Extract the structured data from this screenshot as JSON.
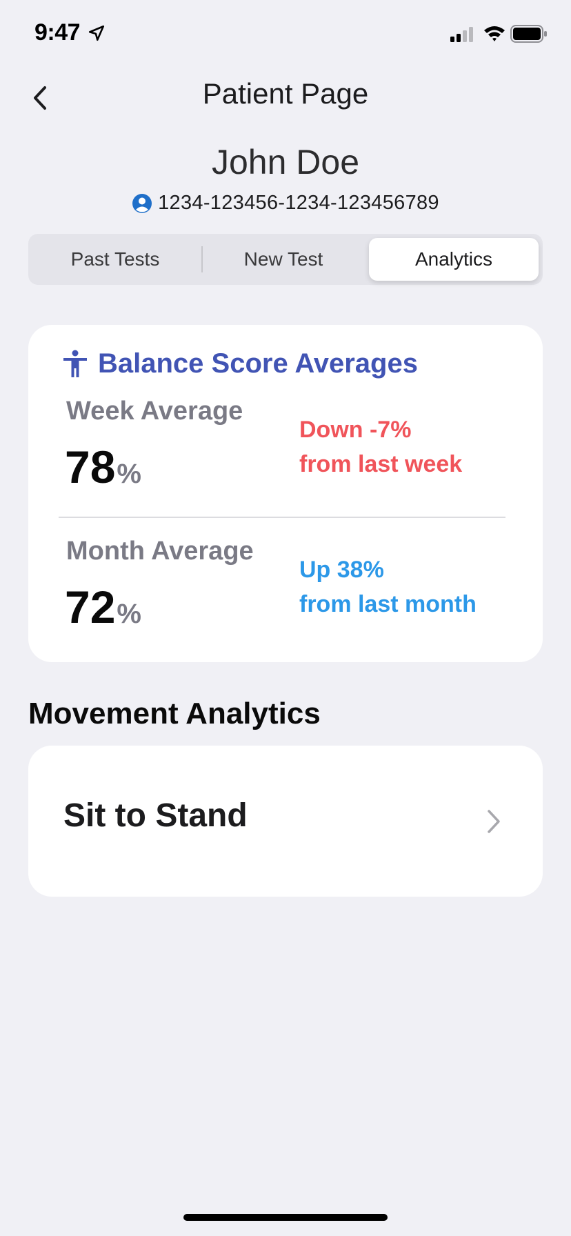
{
  "status_bar": {
    "time": "9:47"
  },
  "nav": {
    "title": "Patient Page"
  },
  "patient": {
    "name": "John Doe",
    "id": "1234-123456-1234-123456789"
  },
  "tabs": [
    {
      "label": "Past Tests",
      "selected": false
    },
    {
      "label": "New Test",
      "selected": false
    },
    {
      "label": "Analytics",
      "selected": true
    }
  ],
  "balance": {
    "title": "Balance Score Averages",
    "week": {
      "label": "Week Average",
      "value": "78",
      "unit": "%",
      "trend_line1": "Down -7%",
      "trend_line2": "from last week"
    },
    "month": {
      "label": "Month Average",
      "value": "72",
      "unit": "%",
      "trend_line1": "Up 38%",
      "trend_line2": "from last month"
    }
  },
  "movement": {
    "section_title": "Movement Analytics",
    "items": [
      {
        "label": "Sit to Stand"
      }
    ]
  },
  "colors": {
    "accent": "#4154b4",
    "trend_down": "#f0545a",
    "trend_up": "#2c98e8",
    "background": "#f0f0f5"
  },
  "icons": {
    "back": "chevron-left-icon",
    "patient": "user-circle-icon",
    "balance": "accessibility-person-icon",
    "row": "chevron-right-icon"
  }
}
